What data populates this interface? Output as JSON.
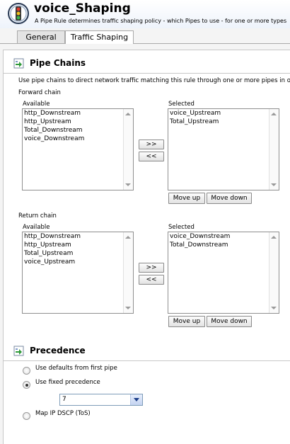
{
  "header": {
    "title": "voice_Shaping",
    "subtitle": "A Pipe Rule determines traffic shaping policy - which Pipes to use - for one or more types"
  },
  "tabs": [
    {
      "label": "General"
    },
    {
      "label": "Traffic Shaping"
    }
  ],
  "pipe_chains": {
    "title": "Pipe Chains",
    "description": "Use pipe chains to direct network traffic matching this rule through one or more pipes in order",
    "forward": {
      "label": "Forward chain",
      "available_label": "Available",
      "selected_label": "Selected",
      "available": [
        "http_Downstream",
        "http_Upstream",
        "Total_Downstream",
        "voice_Downstream"
      ],
      "selected": [
        "voice_Upstream",
        "Total_Upstream"
      ]
    },
    "return": {
      "label": "Return chain",
      "available_label": "Available",
      "selected_label": "Selected",
      "available": [
        "http_Downstream",
        "http_Upstream",
        "Total_Upstream",
        "voice_Upstream"
      ],
      "selected": [
        "voice_Downstream",
        "Total_Downstream"
      ]
    },
    "add_label": ">>",
    "remove_label": "<<",
    "move_up_label": "Move up",
    "move_down_label": "Move down"
  },
  "precedence": {
    "title": "Precedence",
    "options": [
      {
        "label": "Use defaults from first pipe",
        "checked": false
      },
      {
        "label": "Use fixed precedence",
        "checked": true
      },
      {
        "label": "Map IP DSCP (ToS)",
        "checked": false
      }
    ],
    "fixed_value": "7"
  }
}
